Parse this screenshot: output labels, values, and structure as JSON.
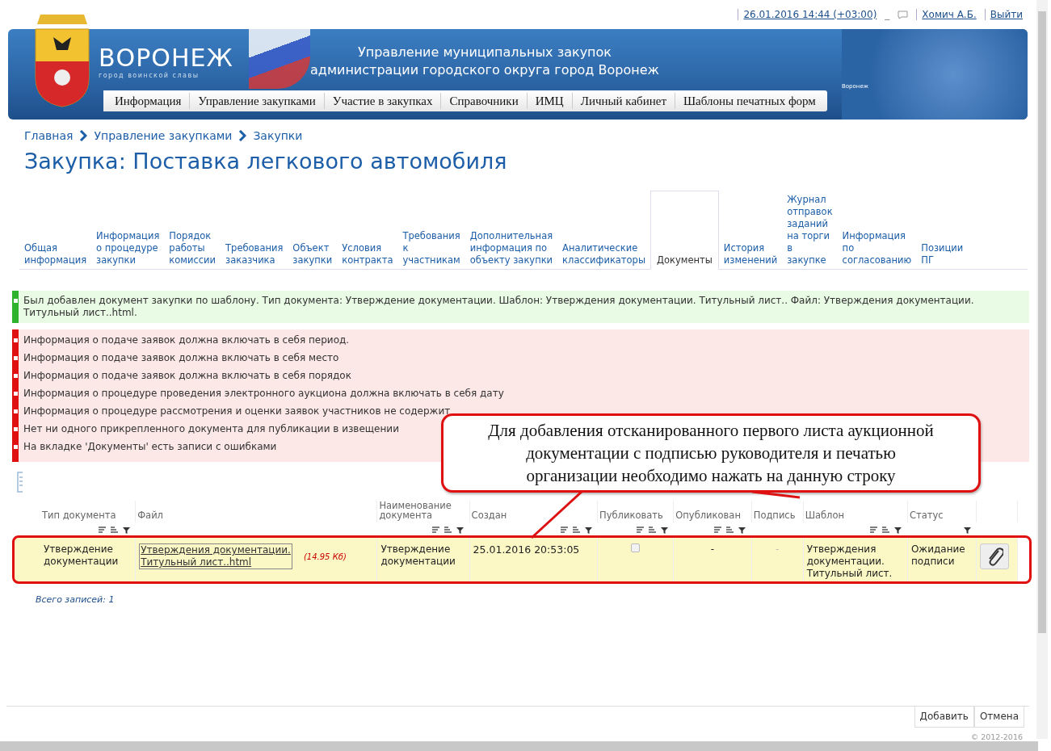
{
  "top_bar": {
    "datetime": "26.01.2016 14:44 (+03:00)",
    "separator": "_",
    "user": "Хомич А.Б.",
    "logout": "Выйти"
  },
  "banner": {
    "city": "ВОРОНЕЖ",
    "motto": "город воинской славы",
    "title_line1": "Управление муниципальных закупок",
    "title_line2": "администрации городского округа город Воронеж",
    "map_label": "Воронеж"
  },
  "menu": [
    {
      "label": "Информация"
    },
    {
      "label": "Управление закупками"
    },
    {
      "label": "Участие в закупках"
    },
    {
      "label": "Справочники"
    },
    {
      "label": "ИМЦ"
    },
    {
      "label": "Личный кабинет"
    },
    {
      "label": "Шаблоны печатных форм"
    }
  ],
  "breadcrumbs": [
    "Главная",
    "Управление закупками",
    "Закупки"
  ],
  "page_title": "Закупка: Поставка легкового автомобиля",
  "tabs": [
    {
      "label": "Общая\nинформация",
      "selected": false
    },
    {
      "label": "Информация\nо процедуре\nзакупки",
      "selected": false
    },
    {
      "label": "Порядок\nработы\nкомиссии",
      "selected": false
    },
    {
      "label": "Требования\nзаказчика",
      "selected": false
    },
    {
      "label": "Объект\nзакупки",
      "selected": false
    },
    {
      "label": "Условия\nконтракта",
      "selected": false
    },
    {
      "label": "Требования\nк\nучастникам",
      "selected": false
    },
    {
      "label": "Дополнительная\nинформация по\nобъекту закупки",
      "selected": false
    },
    {
      "label": "Аналитические\nклассификаторы",
      "selected": false
    },
    {
      "label": "Документы",
      "selected": true
    },
    {
      "label": "История\nизменений",
      "selected": false
    },
    {
      "label": "Журнал\nотправок\nзаданий\nна торги\nв\nзакупке",
      "selected": false
    },
    {
      "label": "Информация\nпо\nсогласованию",
      "selected": false
    },
    {
      "label": "Позиции\nПГ",
      "selected": false
    }
  ],
  "messages": [
    {
      "kind": "success",
      "lines": [
        "Был добавлен документ закупки по шаблону. Тип документа: Утверждение документации. Шаблон: Утверждения документации. Титульный лист.. Файл: Утверждения документации. Титульный лист..html."
      ]
    },
    {
      "kind": "error",
      "lines": [
        "Информация о подаче заявок должна включать в себя период.",
        "Информация о подаче заявок должна включать в себя место",
        "Информация о подаче заявок должна включать в себя порядок",
        "Информация о процедуре проведения электронного аукциона должна включать в себя дату",
        "Информация о процедуре рассмотрения и оценки заявок участников не содержит",
        "Нет ни одного прикрепленного документа для публикации в извещении",
        "На вкладке 'Документы' есть записи с ошибками"
      ]
    }
  ],
  "table": {
    "columns": [
      {
        "label": "Тип документа",
        "kind": "filterable"
      },
      {
        "label": "Файл",
        "kind": "plain"
      },
      {
        "label": "Наименование\nдокумента",
        "kind": "filterable"
      },
      {
        "label": "Создан",
        "kind": "filterable"
      },
      {
        "label": "Публиковать",
        "kind": "filterable"
      },
      {
        "label": "Опубликован",
        "kind": "filterable"
      },
      {
        "label": "Подпись",
        "kind": "plain"
      },
      {
        "label": "Шаблон",
        "kind": "filterable"
      },
      {
        "label": "Статус",
        "kind": "funnel"
      }
    ],
    "rows": [
      {
        "selected": true,
        "type": "Утверждение\nдокументации",
        "file": "Утверждения документации.\nТитульный лист..html",
        "file_size": "(14.95 Кб)",
        "name": "Утверждение\nдокументации",
        "created": "25.01.2016 20:53:05",
        "publish_checked": false,
        "published": "-",
        "signature": "-",
        "template": "Утверждения\nдокументации.\nТитульный лист.",
        "status": "Ожидание\nподписи"
      }
    ],
    "total": "Всего записей: 1"
  },
  "callout": {
    "text": "Для добавления отсканированного первого листа аукционной документации с подписью руководителя и печатью организации необходимо нажать на данную строку"
  },
  "buttons": [
    "Добавить",
    "Отмена"
  ],
  "copyright": "© 2012-2016"
}
